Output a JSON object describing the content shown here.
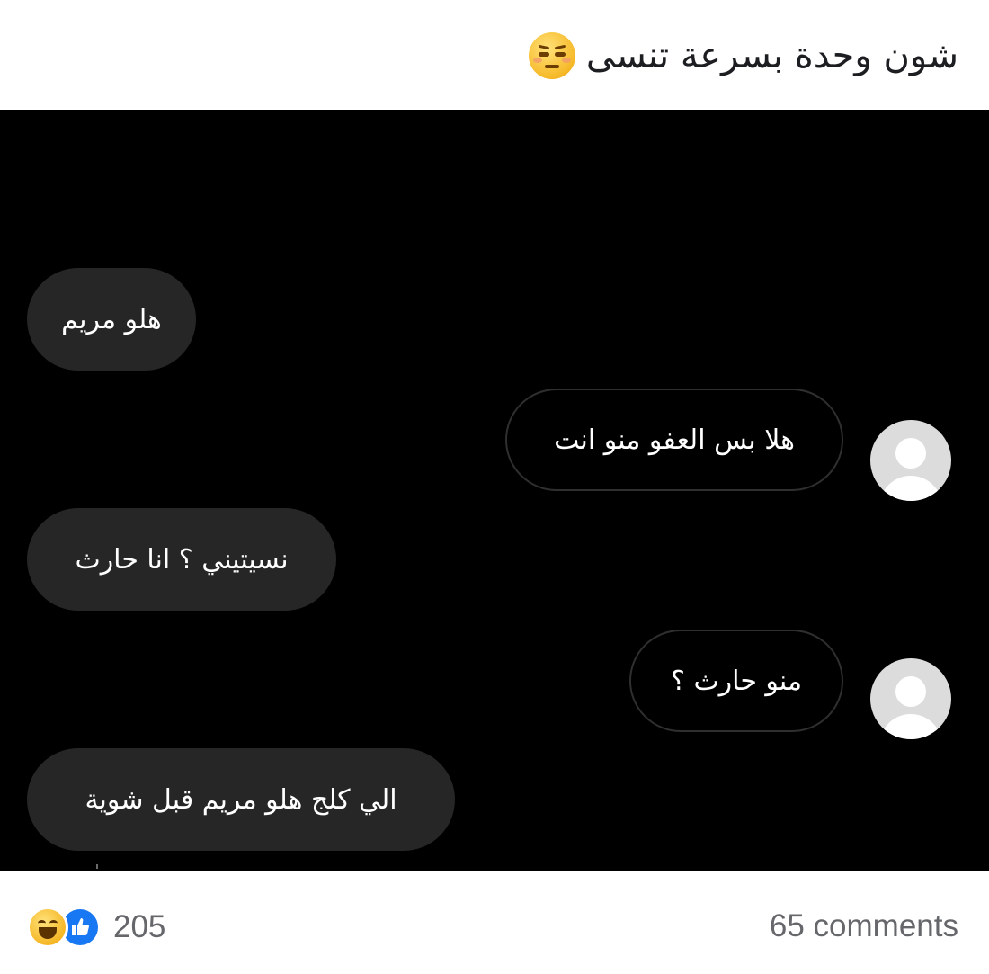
{
  "post": {
    "title": "شون وحدة بسرعة تنسى",
    "title_emoji": "unamused-face-icon"
  },
  "messages": [
    {
      "side": "incoming",
      "text": "هلو مريم"
    },
    {
      "side": "outgoing",
      "text": "هلا بس العفو منو انت"
    },
    {
      "side": "incoming",
      "text": "نسيتيني ؟ انا حارث"
    },
    {
      "side": "outgoing",
      "text": "منو حارث ؟"
    },
    {
      "side": "incoming",
      "text": "الي كلج هلو مريم قبل شوية"
    }
  ],
  "footer": {
    "reactions": [
      "haha-icon",
      "like-icon"
    ],
    "reaction_count": "205",
    "comments": "65 comments"
  },
  "colors": {
    "chat_background": "#000000",
    "incoming_bubble": "#262626",
    "outgoing_border": "#2f2f2f",
    "meta_text": "#65676b",
    "like_blue": "#1877f2"
  }
}
